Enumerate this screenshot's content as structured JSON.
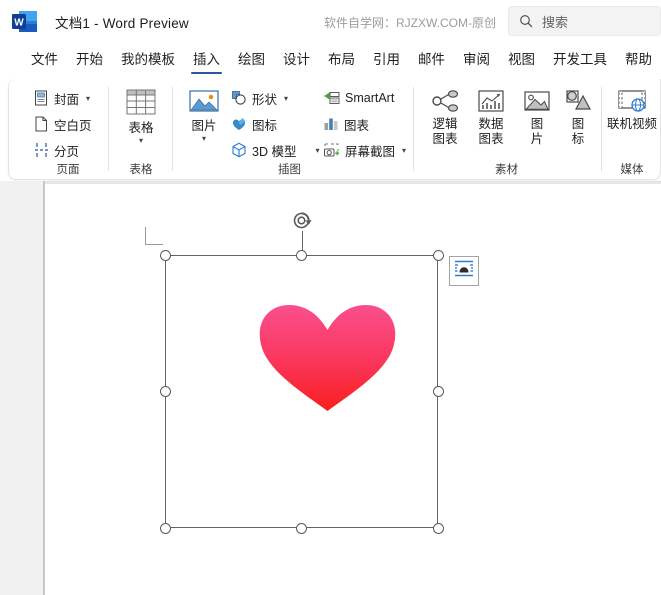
{
  "window": {
    "app_icon": "word-logo-icon",
    "doc_title": "文档1  -  Word Preview",
    "watermark": "软件自学网：RJZXW.COM-原创"
  },
  "search": {
    "icon": "search-icon",
    "placeholder": "搜索",
    "value": ""
  },
  "tabs": [
    {
      "label": "文件",
      "active": false
    },
    {
      "label": "开始",
      "active": false
    },
    {
      "label": "我的模板",
      "active": false
    },
    {
      "label": "插入",
      "active": true
    },
    {
      "label": "绘图",
      "active": false
    },
    {
      "label": "设计",
      "active": false
    },
    {
      "label": "布局",
      "active": false
    },
    {
      "label": "引用",
      "active": false
    },
    {
      "label": "邮件",
      "active": false
    },
    {
      "label": "审阅",
      "active": false
    },
    {
      "label": "视图",
      "active": false
    },
    {
      "label": "开发工具",
      "active": false
    },
    {
      "label": "帮助",
      "active": false
    }
  ],
  "ribbon": {
    "groups": [
      {
        "name": "页面",
        "items": [
          {
            "label": "封面",
            "icon": "cover-page-icon",
            "dropdown": true
          },
          {
            "label": "空白页",
            "icon": "blank-page-icon",
            "dropdown": false
          },
          {
            "label": "分页",
            "icon": "page-break-icon",
            "dropdown": false
          }
        ]
      },
      {
        "name": "表格",
        "items": [
          {
            "label": "表格",
            "icon": "table-icon",
            "dropdown": true
          }
        ]
      },
      {
        "name": "插图",
        "items": [
          {
            "label": "图片",
            "icon": "picture-icon",
            "dropdown": true
          },
          {
            "label": "形状",
            "icon": "shapes-icon",
            "dropdown": true
          },
          {
            "label": "图标",
            "icon": "icons-icon",
            "dropdown": false
          },
          {
            "label": "3D 模型",
            "icon": "3d-model-icon",
            "dropdown": true
          },
          {
            "label": "SmartArt",
            "icon": "smartart-icon",
            "dropdown": false
          },
          {
            "label": "图表",
            "icon": "chart-icon",
            "dropdown": false
          },
          {
            "label": "屏幕截图",
            "icon": "screenshot-icon",
            "dropdown": true
          }
        ]
      },
      {
        "name": "素材",
        "items": [
          {
            "label_line1": "逻辑",
            "label_line2": "图表",
            "icon": "logic-diagram-icon"
          },
          {
            "label_line1": "数据",
            "label_line2": "图表",
            "icon": "data-chart-icon"
          },
          {
            "label_line1": "图",
            "label_line2": "片",
            "icon": "material-picture-icon"
          },
          {
            "label_line1": "图",
            "label_line2": "标",
            "icon": "material-icon-icon"
          }
        ]
      },
      {
        "name": "媒体",
        "items": [
          {
            "label": "联机视频",
            "icon": "online-video-icon"
          }
        ]
      }
    ]
  },
  "document": {
    "selected_object": {
      "name": "heart-image",
      "gradient_top": "#FA4F8C",
      "gradient_bottom": "#FA1E1E",
      "handles": [
        "top-left",
        "top-center",
        "top-right",
        "middle-left",
        "middle-right",
        "bottom-left",
        "bottom-center",
        "bottom-right"
      ],
      "rotation_handle": "rotate-icon",
      "layout_options": {
        "icon": "layout-options-icon",
        "label": "布局选项"
      }
    }
  }
}
